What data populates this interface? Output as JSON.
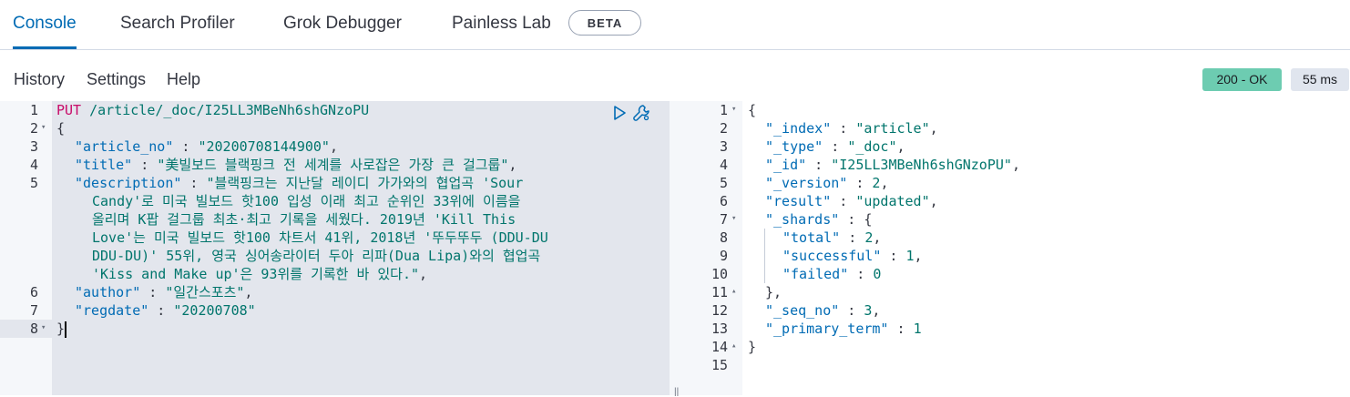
{
  "tabs": [
    "Console",
    "Search Profiler",
    "Grok Debugger",
    "Painless Lab"
  ],
  "beta_badge": "BETA",
  "menu": [
    "History",
    "Settings",
    "Help"
  ],
  "status": {
    "code": "200 - OK",
    "time": "55 ms"
  },
  "request": {
    "line_numbers": [
      "1",
      "2",
      "3",
      "4",
      "5",
      "",
      "",
      "",
      "",
      "",
      "6",
      "7",
      "8"
    ],
    "lines": [
      {
        "method": "PUT",
        "url": " /article/_doc/I25LL3MBeNh6shGNzoPU"
      },
      {
        "text": "{"
      },
      {
        "key": "\"article_no\"",
        "sep": " : ",
        "value": "\"20200708144900\"",
        "tail": ","
      },
      {
        "key": "\"title\"",
        "sep": " : ",
        "value": "\"美빌보드 블랙핑크 전 세계를 사로잡은 가장 큰 걸그룹\"",
        "tail": ","
      },
      {
        "key": "\"description\"",
        "sep": " : ",
        "value": "\"블랙핑크는 지난달 레이디 가가와의 협업곡 'Sour"
      },
      {
        "value": "Candy'로 미국 빌보드 핫100 입성 이래 최고 순위인 33위에 이름을"
      },
      {
        "value": "올리며 K팝 걸그룹 최초·최고 기록을 세웠다. 2019년 'Kill This"
      },
      {
        "value": "Love'는 미국 빌보드 핫100 차트서 41위, 2018년 '뚜두뚜두 (DDU-DU"
      },
      {
        "value": "DDU-DU)' 55위, 영국 싱어송라이터 두아 리파(Dua Lipa)와의 협업곡"
      },
      {
        "value": "'Kiss and Make up'은 93위를 기록한 바 있다.\"",
        "tail": ","
      },
      {
        "key": "\"author\"",
        "sep": " : ",
        "value": "\"일간스포츠\"",
        "tail": ","
      },
      {
        "key": "\"regdate\"",
        "sep": " : ",
        "value": "\"20200708\""
      },
      {
        "text": "}"
      }
    ]
  },
  "response": {
    "line_numbers": [
      "1",
      "2",
      "3",
      "4",
      "5",
      "6",
      "7",
      "8",
      "9",
      "10",
      "11",
      "12",
      "13",
      "14",
      "15"
    ],
    "lines": [
      {
        "text": "{"
      },
      {
        "key": "\"_index\"",
        "sep": " : ",
        "value": "\"article\"",
        "tail": ","
      },
      {
        "key": "\"_type\"",
        "sep": " : ",
        "value": "\"_doc\"",
        "tail": ","
      },
      {
        "key": "\"_id\"",
        "sep": " : ",
        "value": "\"I25LL3MBeNh6shGNzoPU\"",
        "tail": ","
      },
      {
        "key": "\"_version\"",
        "sep": " : ",
        "value": "2",
        "tail": ","
      },
      {
        "key": "\"result\"",
        "sep": " : ",
        "value": "\"updated\"",
        "tail": ","
      },
      {
        "key": "\"_shards\"",
        "sep": " : ",
        "tail": "{"
      },
      {
        "key": "\"total\"",
        "sep": " : ",
        "value": "2",
        "tail": ","
      },
      {
        "key": "\"successful\"",
        "sep": " : ",
        "value": "1",
        "tail": ","
      },
      {
        "key": "\"failed\"",
        "sep": " : ",
        "value": "0"
      },
      {
        "text": "},"
      },
      {
        "key": "\"_seq_no\"",
        "sep": " : ",
        "value": "3",
        "tail": ","
      },
      {
        "key": "\"_primary_term\"",
        "sep": " : ",
        "value": "1"
      },
      {
        "text": "}"
      },
      {
        "text": ""
      }
    ]
  }
}
